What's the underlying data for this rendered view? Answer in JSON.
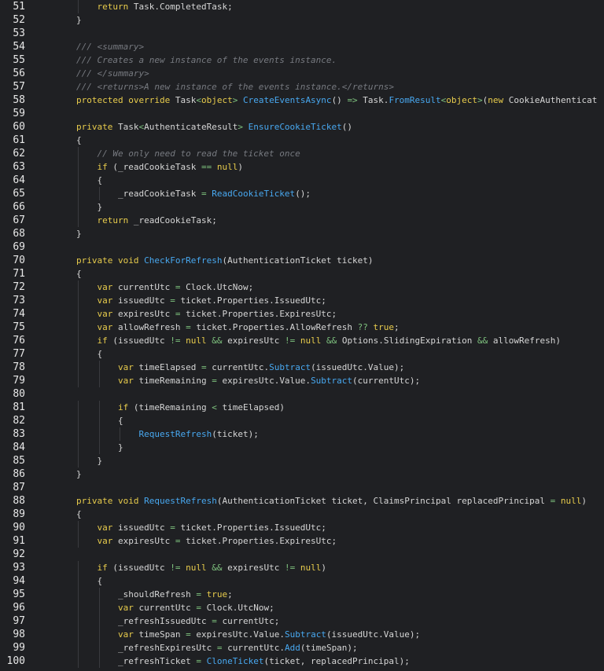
{
  "editor": {
    "colors": {
      "background": "#1f2023",
      "keyword": "#e8cc4c",
      "method": "#48a8f0",
      "operator": "#7ec27e",
      "comment": "#777a80",
      "plain": "#d6d6d6",
      "line_number": "#e8e8e8"
    },
    "lines": [
      {
        "n": "51",
        "indent": 2,
        "tokens": [
          [
            "kw",
            "return"
          ],
          [
            "plain",
            " Task.CompletedTask;"
          ]
        ]
      },
      {
        "n": "52",
        "indent": 1,
        "tokens": [
          [
            "plain",
            "}"
          ]
        ]
      },
      {
        "n": "53",
        "indent": 0,
        "tokens": []
      },
      {
        "n": "54",
        "indent": 1,
        "tokens": [
          [
            "com",
            "/// <summary>"
          ]
        ]
      },
      {
        "n": "55",
        "indent": 1,
        "tokens": [
          [
            "com",
            "/// Creates a new instance of the events instance."
          ]
        ]
      },
      {
        "n": "56",
        "indent": 1,
        "tokens": [
          [
            "com",
            "/// </summary>"
          ]
        ]
      },
      {
        "n": "57",
        "indent": 1,
        "tokens": [
          [
            "com",
            "/// <returns>A new instance of the events instance.</returns>"
          ]
        ]
      },
      {
        "n": "58",
        "indent": 1,
        "tokens": [
          [
            "kw",
            "protected override"
          ],
          [
            "plain",
            " Task"
          ],
          [
            "op",
            "<"
          ],
          [
            "kw",
            "object"
          ],
          [
            "op",
            ">"
          ],
          [
            "plain",
            " "
          ],
          [
            "meth",
            "CreateEventsAsync"
          ],
          [
            "plain",
            "() "
          ],
          [
            "op",
            "=>"
          ],
          [
            "plain",
            " Task."
          ],
          [
            "meth",
            "FromResult"
          ],
          [
            "op",
            "<"
          ],
          [
            "kw",
            "object"
          ],
          [
            "op",
            ">"
          ],
          [
            "plain",
            "("
          ],
          [
            "kw",
            "new"
          ],
          [
            "plain",
            " CookieAuthenticat"
          ]
        ]
      },
      {
        "n": "59",
        "indent": 0,
        "tokens": []
      },
      {
        "n": "60",
        "indent": 1,
        "tokens": [
          [
            "kw",
            "private"
          ],
          [
            "plain",
            " Task"
          ],
          [
            "op",
            "<"
          ],
          [
            "plain",
            "AuthenticateResult"
          ],
          [
            "op",
            ">"
          ],
          [
            "plain",
            " "
          ],
          [
            "meth",
            "EnsureCookieTicket"
          ],
          [
            "plain",
            "()"
          ]
        ]
      },
      {
        "n": "61",
        "indent": 1,
        "tokens": [
          [
            "plain",
            "{"
          ]
        ]
      },
      {
        "n": "62",
        "indent": 2,
        "tokens": [
          [
            "com",
            "// We only need to read the ticket once"
          ]
        ]
      },
      {
        "n": "63",
        "indent": 2,
        "tokens": [
          [
            "kw",
            "if"
          ],
          [
            "plain",
            " (_readCookieTask "
          ],
          [
            "op",
            "=="
          ],
          [
            "plain",
            " "
          ],
          [
            "kw",
            "null"
          ],
          [
            "plain",
            ")"
          ]
        ]
      },
      {
        "n": "64",
        "indent": 2,
        "tokens": [
          [
            "plain",
            "{"
          ]
        ]
      },
      {
        "n": "65",
        "indent": 3,
        "tokens": [
          [
            "plain",
            "_readCookieTask "
          ],
          [
            "op",
            "="
          ],
          [
            "plain",
            " "
          ],
          [
            "meth",
            "ReadCookieTicket"
          ],
          [
            "plain",
            "();"
          ]
        ]
      },
      {
        "n": "66",
        "indent": 2,
        "tokens": [
          [
            "plain",
            "}"
          ]
        ]
      },
      {
        "n": "67",
        "indent": 2,
        "tokens": [
          [
            "kw",
            "return"
          ],
          [
            "plain",
            " _readCookieTask;"
          ]
        ]
      },
      {
        "n": "68",
        "indent": 1,
        "tokens": [
          [
            "plain",
            "}"
          ]
        ]
      },
      {
        "n": "69",
        "indent": 0,
        "tokens": []
      },
      {
        "n": "70",
        "indent": 1,
        "tokens": [
          [
            "kw",
            "private void"
          ],
          [
            "plain",
            " "
          ],
          [
            "meth",
            "CheckForRefresh"
          ],
          [
            "plain",
            "(AuthenticationTicket ticket)"
          ]
        ]
      },
      {
        "n": "71",
        "indent": 1,
        "tokens": [
          [
            "plain",
            "{"
          ]
        ]
      },
      {
        "n": "72",
        "indent": 2,
        "tokens": [
          [
            "kw",
            "var"
          ],
          [
            "plain",
            " currentUtc "
          ],
          [
            "op",
            "="
          ],
          [
            "plain",
            " Clock.UtcNow;"
          ]
        ]
      },
      {
        "n": "73",
        "indent": 2,
        "tokens": [
          [
            "kw",
            "var"
          ],
          [
            "plain",
            " issuedUtc "
          ],
          [
            "op",
            "="
          ],
          [
            "plain",
            " ticket.Properties.IssuedUtc;"
          ]
        ]
      },
      {
        "n": "74",
        "indent": 2,
        "tokens": [
          [
            "kw",
            "var"
          ],
          [
            "plain",
            " expiresUtc "
          ],
          [
            "op",
            "="
          ],
          [
            "plain",
            " ticket.Properties.ExpiresUtc;"
          ]
        ]
      },
      {
        "n": "75",
        "indent": 2,
        "tokens": [
          [
            "kw",
            "var"
          ],
          [
            "plain",
            " allowRefresh "
          ],
          [
            "op",
            "="
          ],
          [
            "plain",
            " ticket.Properties.AllowRefresh "
          ],
          [
            "op",
            "??"
          ],
          [
            "plain",
            " "
          ],
          [
            "kw",
            "true"
          ],
          [
            "plain",
            ";"
          ]
        ]
      },
      {
        "n": "76",
        "indent": 2,
        "tokens": [
          [
            "kw",
            "if"
          ],
          [
            "plain",
            " (issuedUtc "
          ],
          [
            "op",
            "!="
          ],
          [
            "plain",
            " "
          ],
          [
            "kw",
            "null"
          ],
          [
            "plain",
            " "
          ],
          [
            "op",
            "&&"
          ],
          [
            "plain",
            " expiresUtc "
          ],
          [
            "op",
            "!="
          ],
          [
            "plain",
            " "
          ],
          [
            "kw",
            "null"
          ],
          [
            "plain",
            " "
          ],
          [
            "op",
            "&&"
          ],
          [
            "plain",
            " Options.SlidingExpiration "
          ],
          [
            "op",
            "&&"
          ],
          [
            "plain",
            " allowRefresh)"
          ]
        ]
      },
      {
        "n": "77",
        "indent": 2,
        "tokens": [
          [
            "plain",
            "{"
          ]
        ]
      },
      {
        "n": "78",
        "indent": 3,
        "tokens": [
          [
            "kw",
            "var"
          ],
          [
            "plain",
            " timeElapsed "
          ],
          [
            "op",
            "="
          ],
          [
            "plain",
            " currentUtc."
          ],
          [
            "meth",
            "Subtract"
          ],
          [
            "plain",
            "(issuedUtc.Value);"
          ]
        ]
      },
      {
        "n": "79",
        "indent": 3,
        "tokens": [
          [
            "kw",
            "var"
          ],
          [
            "plain",
            " timeRemaining "
          ],
          [
            "op",
            "="
          ],
          [
            "plain",
            " expiresUtc.Value."
          ],
          [
            "meth",
            "Subtract"
          ],
          [
            "plain",
            "(currentUtc);"
          ]
        ]
      },
      {
        "n": "80",
        "indent": 0,
        "tokens": []
      },
      {
        "n": "81",
        "indent": 3,
        "tokens": [
          [
            "kw",
            "if"
          ],
          [
            "plain",
            " (timeRemaining "
          ],
          [
            "op",
            "<"
          ],
          [
            "plain",
            " timeElapsed)"
          ]
        ]
      },
      {
        "n": "82",
        "indent": 3,
        "tokens": [
          [
            "plain",
            "{"
          ]
        ]
      },
      {
        "n": "83",
        "indent": 4,
        "tokens": [
          [
            "meth",
            "RequestRefresh"
          ],
          [
            "plain",
            "(ticket);"
          ]
        ]
      },
      {
        "n": "84",
        "indent": 3,
        "tokens": [
          [
            "plain",
            "}"
          ]
        ]
      },
      {
        "n": "85",
        "indent": 2,
        "tokens": [
          [
            "plain",
            "}"
          ]
        ]
      },
      {
        "n": "86",
        "indent": 1,
        "tokens": [
          [
            "plain",
            "}"
          ]
        ]
      },
      {
        "n": "87",
        "indent": 0,
        "tokens": []
      },
      {
        "n": "88",
        "indent": 1,
        "tokens": [
          [
            "kw",
            "private void"
          ],
          [
            "plain",
            " "
          ],
          [
            "meth",
            "RequestRefresh"
          ],
          [
            "plain",
            "(AuthenticationTicket ticket, ClaimsPrincipal replacedPrincipal "
          ],
          [
            "op",
            "="
          ],
          [
            "plain",
            " "
          ],
          [
            "kw",
            "null"
          ],
          [
            "plain",
            ")"
          ]
        ]
      },
      {
        "n": "89",
        "indent": 1,
        "tokens": [
          [
            "plain",
            "{"
          ]
        ]
      },
      {
        "n": "90",
        "indent": 2,
        "tokens": [
          [
            "kw",
            "var"
          ],
          [
            "plain",
            " issuedUtc "
          ],
          [
            "op",
            "="
          ],
          [
            "plain",
            " ticket.Properties.IssuedUtc;"
          ]
        ]
      },
      {
        "n": "91",
        "indent": 2,
        "tokens": [
          [
            "kw",
            "var"
          ],
          [
            "plain",
            " expiresUtc "
          ],
          [
            "op",
            "="
          ],
          [
            "plain",
            " ticket.Properties.ExpiresUtc;"
          ]
        ]
      },
      {
        "n": "92",
        "indent": 0,
        "tokens": []
      },
      {
        "n": "93",
        "indent": 2,
        "tokens": [
          [
            "kw",
            "if"
          ],
          [
            "plain",
            " (issuedUtc "
          ],
          [
            "op",
            "!="
          ],
          [
            "plain",
            " "
          ],
          [
            "kw",
            "null"
          ],
          [
            "plain",
            " "
          ],
          [
            "op",
            "&&"
          ],
          [
            "plain",
            " expiresUtc "
          ],
          [
            "op",
            "!="
          ],
          [
            "plain",
            " "
          ],
          [
            "kw",
            "null"
          ],
          [
            "plain",
            ")"
          ]
        ]
      },
      {
        "n": "94",
        "indent": 2,
        "tokens": [
          [
            "plain",
            "{"
          ]
        ]
      },
      {
        "n": "95",
        "indent": 3,
        "tokens": [
          [
            "plain",
            "_shouldRefresh "
          ],
          [
            "op",
            "="
          ],
          [
            "plain",
            " "
          ],
          [
            "kw",
            "true"
          ],
          [
            "plain",
            ";"
          ]
        ]
      },
      {
        "n": "96",
        "indent": 3,
        "tokens": [
          [
            "kw",
            "var"
          ],
          [
            "plain",
            " currentUtc "
          ],
          [
            "op",
            "="
          ],
          [
            "plain",
            " Clock.UtcNow;"
          ]
        ]
      },
      {
        "n": "97",
        "indent": 3,
        "tokens": [
          [
            "plain",
            "_refreshIssuedUtc "
          ],
          [
            "op",
            "="
          ],
          [
            "plain",
            " currentUtc;"
          ]
        ]
      },
      {
        "n": "98",
        "indent": 3,
        "tokens": [
          [
            "kw",
            "var"
          ],
          [
            "plain",
            " timeSpan "
          ],
          [
            "op",
            "="
          ],
          [
            "plain",
            " expiresUtc.Value."
          ],
          [
            "meth",
            "Subtract"
          ],
          [
            "plain",
            "(issuedUtc.Value);"
          ]
        ]
      },
      {
        "n": "99",
        "indent": 3,
        "tokens": [
          [
            "plain",
            "_refreshExpiresUtc "
          ],
          [
            "op",
            "="
          ],
          [
            "plain",
            " currentUtc."
          ],
          [
            "meth",
            "Add"
          ],
          [
            "plain",
            "(timeSpan);"
          ]
        ]
      },
      {
        "n": "100",
        "indent": 3,
        "tokens": [
          [
            "plain",
            "_refreshTicket "
          ],
          [
            "op",
            "="
          ],
          [
            "plain",
            " "
          ],
          [
            "meth",
            "CloneTicket"
          ],
          [
            "plain",
            "(ticket, replacedPrincipal);"
          ]
        ]
      }
    ]
  }
}
